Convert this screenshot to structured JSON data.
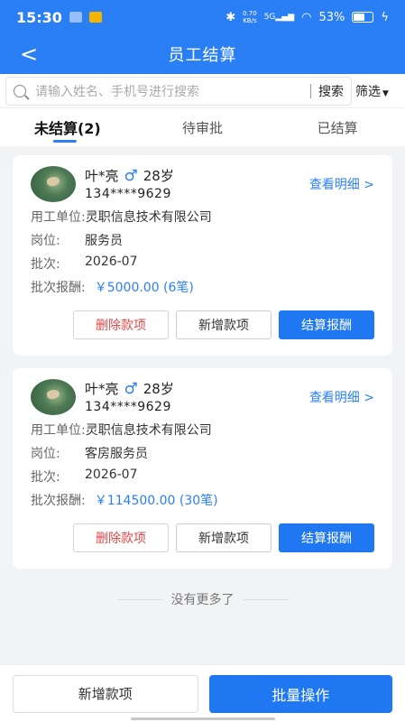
{
  "status_bar": {
    "time": "15:30",
    "net_speed_value": "0.70",
    "net_speed_unit": "KB/s",
    "network": "5G",
    "battery": "53%"
  },
  "header": {
    "title": "员工结算"
  },
  "search": {
    "placeholder": "请输入姓名、手机号进行搜索",
    "button": "搜索",
    "filter": "筛选"
  },
  "tabs": [
    {
      "label": "未结算(2)"
    },
    {
      "label": "待审批"
    },
    {
      "label": "已结算"
    }
  ],
  "cards": [
    {
      "name": "叶*亮",
      "gender": "♂",
      "age": "28岁",
      "phone": "134****9629",
      "detail_link": "查看明细 >",
      "employer_label": "用工单位:",
      "employer": "灵职信息技术有限公司",
      "post_label": "岗位:",
      "post": "服务员",
      "batch_label": "批次:",
      "batch": "2026-07",
      "pay_label": "批次报酬:",
      "pay": "￥5000.00 (6笔)",
      "btn_delete": "删除款项",
      "btn_add": "新增款项",
      "btn_settle": "结算报酬"
    },
    {
      "name": "叶*亮",
      "gender": "♂",
      "age": "28岁",
      "phone": "134****9629",
      "detail_link": "查看明细 >",
      "employer_label": "用工单位:",
      "employer": "灵职信息技术有限公司",
      "post_label": "岗位:",
      "post": "客房服务员",
      "batch_label": "批次:",
      "batch": "2026-07",
      "pay_label": "批次报酬:",
      "pay": "￥114500.00 (30笔)",
      "btn_delete": "删除款项",
      "btn_add": "新增款项",
      "btn_settle": "结算报酬"
    }
  ],
  "no_more": "没有更多了",
  "bottom": {
    "add": "新增款项",
    "batch": "批量操作"
  },
  "colors": {
    "primary": "#2b7ff5",
    "danger": "#e04848"
  }
}
